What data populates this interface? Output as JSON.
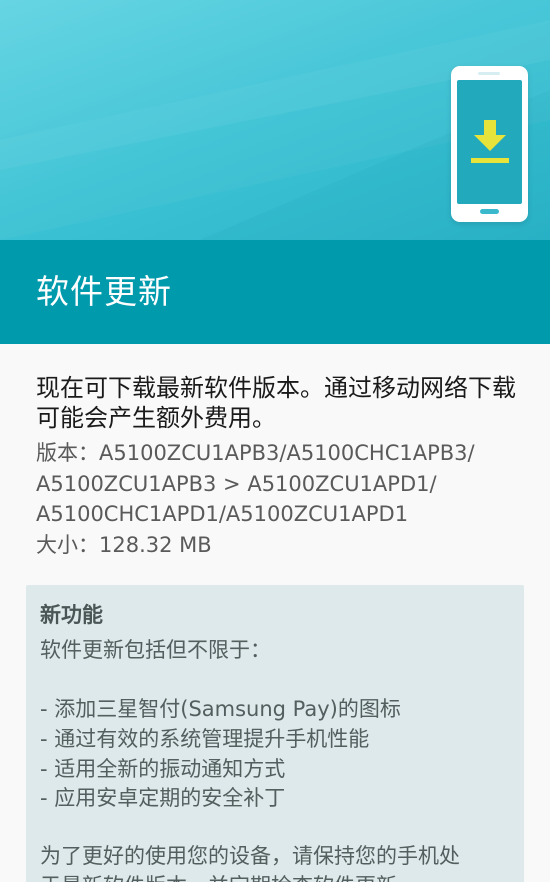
{
  "header": {
    "title": "软件更新",
    "hero_icon": "download-icon",
    "colors": {
      "hero": "#3ec4d6",
      "title_bar": "#009aad",
      "icon_yellow": "#e8e33a"
    }
  },
  "update": {
    "intro": "现在可下载最新软件版本。通过移动网络下载可能会产生额外费用。",
    "version_line1": "版本：A5100ZCU1APB3/A5100CHC1APB3/",
    "version_line2": "A5100ZCU1APB3 > A5100ZCU1APD1/",
    "version_line3": "A5100CHC1APD1/A5100ZCU1APD1",
    "size": "大小：128.32 MB"
  },
  "notes": {
    "heading": "新功能",
    "subheading": "软件更新包括但不限于：",
    "items": [
      "- 添加三星智付(Samsung Pay)的图标",
      "- 通过有效的系统管理提升手机性能",
      "- 适用全新的振动通知方式",
      "- 应用安卓定期的安全补丁"
    ],
    "footer_line1": "为了更好的使用您的设备，请保持您的手机处",
    "footer_line2": "于最新软件版本，并定期检查软件更新。"
  }
}
